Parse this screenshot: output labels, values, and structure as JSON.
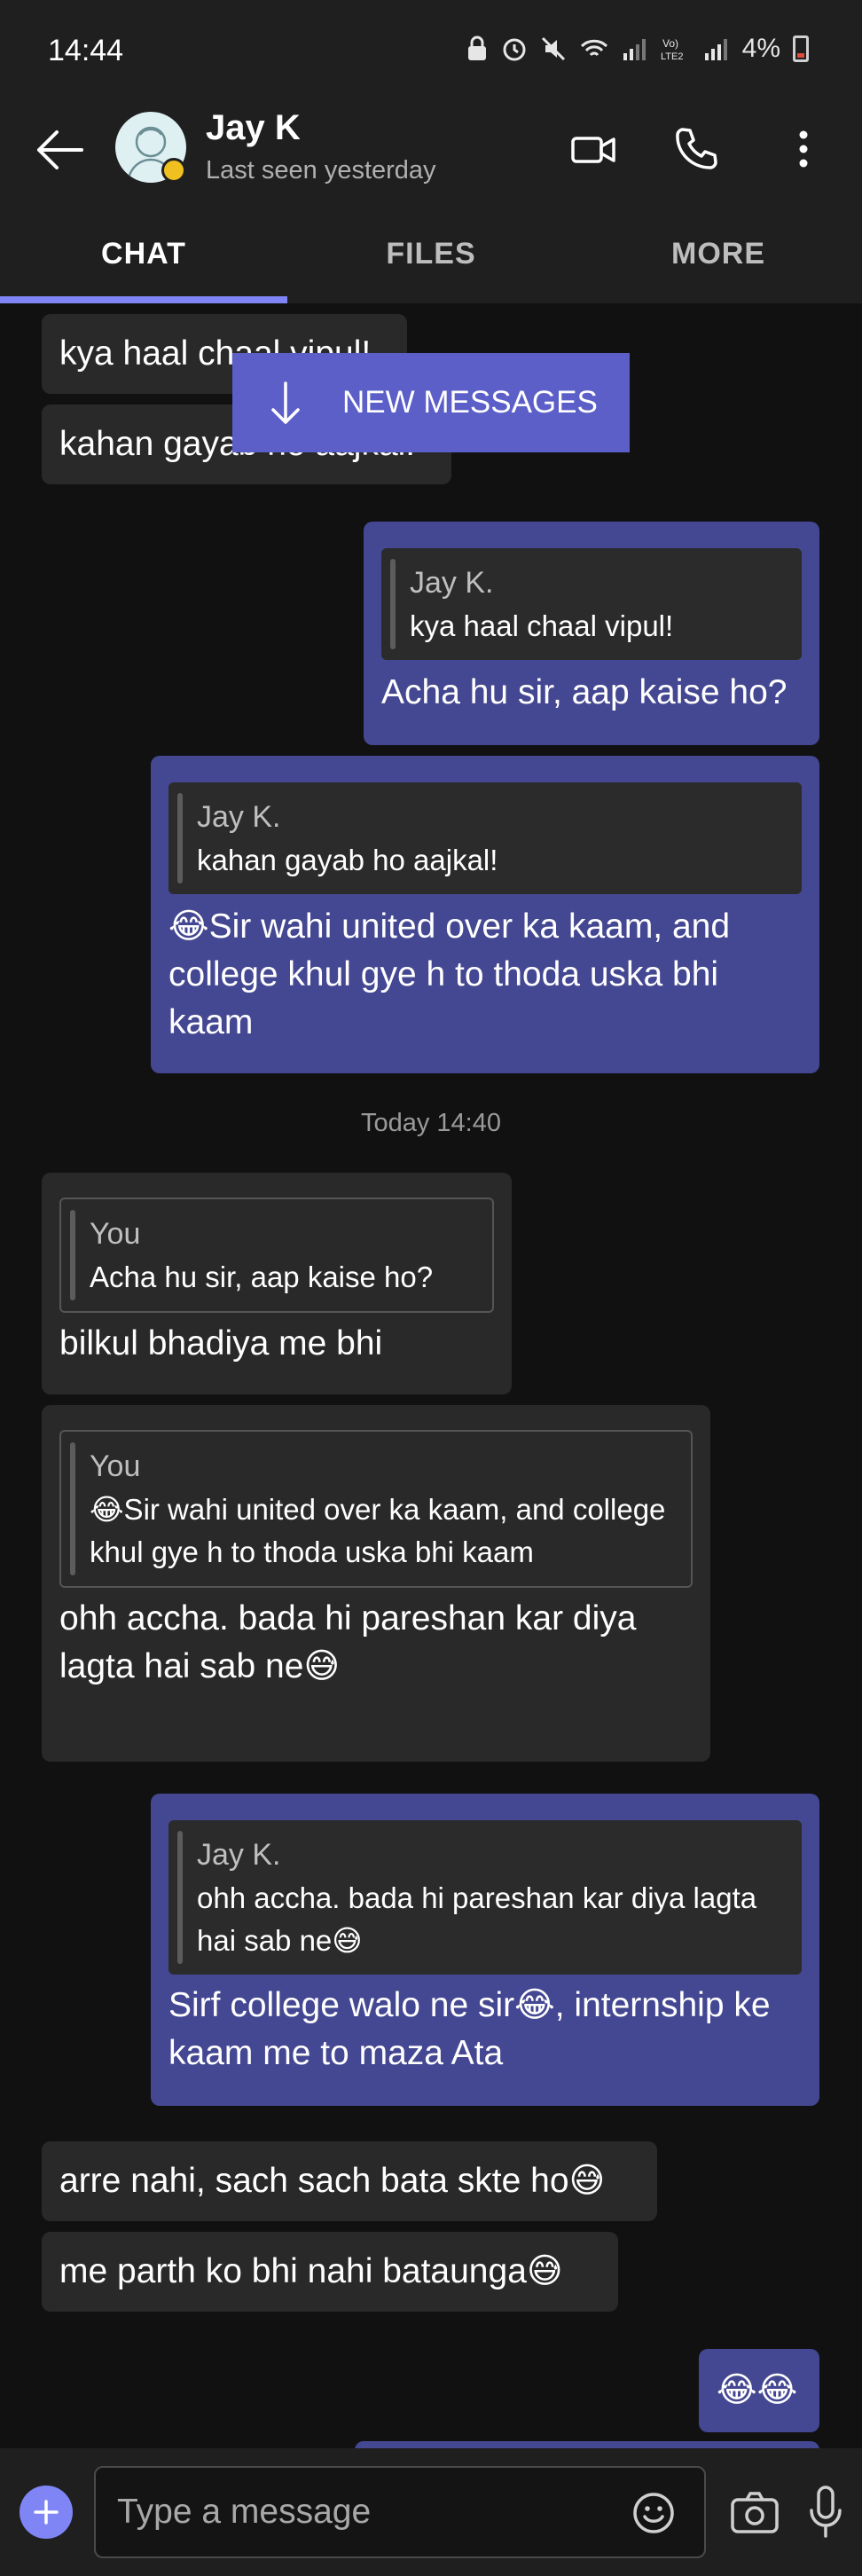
{
  "status_bar": {
    "time": "14:44",
    "icons": [
      "lock-icon",
      "alarm-icon",
      "mute-icon",
      "wifi-call-icon",
      "signal-icon",
      "volte-icon",
      "signal-icon"
    ],
    "volte_label": "Vo)\nLTE2",
    "battery": "4%"
  },
  "header": {
    "name": "Jay K",
    "last_seen": "Last seen yesterday",
    "icons": [
      "back-arrow-icon",
      "video-call-icon",
      "phone-icon",
      "more-vert-icon"
    ]
  },
  "tabs": [
    {
      "label": "CHAT",
      "active": true
    },
    {
      "label": "FILES",
      "active": false
    },
    {
      "label": "MORE",
      "active": false
    }
  ],
  "new_messages_label": "NEW MESSAGES",
  "timestamp": "Today 14:40",
  "messages": [
    {
      "dir": "in",
      "text": "kya haal chaal vipul!"
    },
    {
      "dir": "in",
      "text": "kahan gayab ho aajkal!"
    },
    {
      "dir": "out",
      "quote_author": "Jay K.",
      "quote_text": "kya haal chaal vipul!",
      "text": "Acha hu sir, aap kaise ho?"
    },
    {
      "dir": "out",
      "quote_author": "Jay K.",
      "quote_text": "kahan gayab ho aajkal!",
      "text": "😂Sir wahi united over ka kaam, and college khul gye h to thoda uska bhi kaam"
    },
    {
      "dir": "in",
      "quote_author": "You",
      "quote_text": "Acha hu sir, aap kaise ho?",
      "text": "bilkul bhadiya me bhi"
    },
    {
      "dir": "in",
      "quote_author": "You",
      "quote_text": "😂Sir wahi united over ka kaam, and college khul gye h to thoda uska bhi kaam",
      "text": "ohh accha. bada hi pareshan kar diya lagta hai sab ne😅"
    },
    {
      "dir": "out",
      "quote_author": "Jay K.",
      "quote_text": "ohh accha. bada hi pareshan kar diya lagta hai sab ne😅",
      "text": "Sirf college walo ne sir😂, internship ke kaam me to maza Ata"
    },
    {
      "dir": "in",
      "text": "arre nahi, sach sach bata skte ho😅"
    },
    {
      "dir": "in",
      "text": "me parth ko bhi nahi bataunga😅"
    },
    {
      "dir": "out",
      "text": "😂😂"
    }
  ],
  "compose": {
    "placeholder": "Type a message",
    "icons": [
      "add-icon",
      "emoji-icon",
      "camera-icon",
      "microphone-icon"
    ]
  },
  "colors": {
    "accent": "#7f85f5",
    "outgoing_bubble": "#444791",
    "incoming_bubble": "#292929",
    "background": "#111111",
    "bar": "#1f1f1f"
  }
}
